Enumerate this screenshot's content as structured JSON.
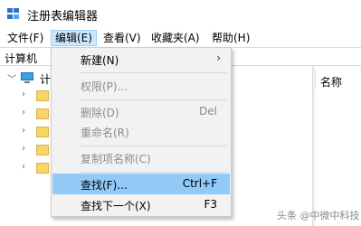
{
  "window": {
    "title": "注册表编辑器",
    "icon": "registry-editor-icon"
  },
  "menubar": {
    "items": [
      {
        "label": "文件(F)"
      },
      {
        "label": "编辑(E)"
      },
      {
        "label": "查看(V)"
      },
      {
        "label": "收藏夹(A)"
      },
      {
        "label": "帮助(H)"
      }
    ],
    "active_index": 1
  },
  "address": {
    "path": "计算机"
  },
  "tree": {
    "root_label": "计",
    "root_icon": "computer-icon",
    "folder_icon": "folder-icon",
    "child_count": 5
  },
  "list": {
    "columns": [
      {
        "label": "名称"
      }
    ]
  },
  "edit_menu": {
    "items": [
      {
        "label": "新建(N)",
        "shortcut": "",
        "submenu": true,
        "disabled": false,
        "highlighted": false
      },
      {
        "label": "权限(P)...",
        "shortcut": "",
        "submenu": false,
        "disabled": true,
        "highlighted": false
      },
      {
        "label": "删除(D)",
        "shortcut": "Del",
        "submenu": false,
        "disabled": true,
        "highlighted": false
      },
      {
        "label": "重命名(R)",
        "shortcut": "",
        "submenu": false,
        "disabled": true,
        "highlighted": false
      },
      {
        "label": "复制项名称(C)",
        "shortcut": "",
        "submenu": false,
        "disabled": true,
        "highlighted": false
      },
      {
        "label": "查找(F)...",
        "shortcut": "Ctrl+F",
        "submenu": false,
        "disabled": false,
        "highlighted": true
      },
      {
        "label": "查找下一个(X)",
        "shortcut": "F3",
        "submenu": false,
        "disabled": false,
        "highlighted": false
      }
    ],
    "submenu_arrow": "›"
  },
  "watermark": {
    "text": "头条 @中微中科技"
  },
  "colors": {
    "menu_highlight": "#91c9f7",
    "menubar_active": "#cce8ff",
    "folder": "#f7d669",
    "disabled_text": "#8c8c8c"
  }
}
